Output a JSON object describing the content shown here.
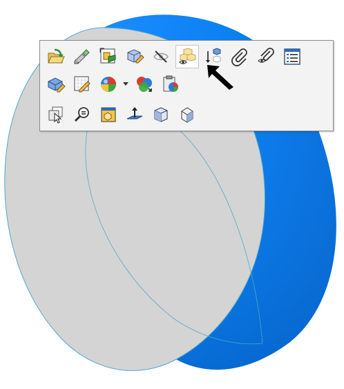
{
  "viewport": {
    "model": "cylinder",
    "face_color": "#d4d4d4",
    "side_color": "#0a7ff0",
    "edge_color": "#4fa8c8"
  },
  "toolbar": {
    "rows": [
      [
        {
          "name": "open-part-icon",
          "interactable": true
        },
        {
          "name": "edit-feature-icon",
          "interactable": true
        },
        {
          "name": "edit-sketch-icon",
          "interactable": true
        },
        {
          "name": "edit-part-icon",
          "interactable": true
        },
        {
          "name": "hide-body-icon",
          "interactable": true
        },
        {
          "name": "show-hidden-bodies-icon",
          "interactable": true,
          "highlighted": true
        },
        {
          "name": "insert-component-icon",
          "interactable": true
        },
        {
          "name": "attach-annotation-icon",
          "interactable": true
        },
        {
          "name": "hide-annotation-icon",
          "interactable": true
        },
        {
          "name": "properties-icon",
          "interactable": true
        }
      ],
      [
        {
          "name": "edit-body-icon",
          "interactable": true
        },
        {
          "name": "edit-drawing-icon",
          "interactable": true
        },
        {
          "name": "appearance-icon",
          "interactable": true,
          "has_dropdown": true
        },
        {
          "name": "copy-appearance-icon",
          "interactable": true
        },
        {
          "name": "paste-appearance-icon",
          "interactable": true
        }
      ],
      [
        {
          "name": "select-other-icon",
          "interactable": true
        },
        {
          "name": "zoom-to-selection-icon",
          "interactable": true
        },
        {
          "name": "normal-to-icon",
          "interactable": true
        },
        {
          "name": "normal-to-plane-icon",
          "interactable": true
        },
        {
          "name": "section-view-icon",
          "interactable": true
        },
        {
          "name": "view-orientation-icon",
          "interactable": true
        }
      ]
    ]
  },
  "cursor": {
    "name": "pointer-arrow"
  }
}
